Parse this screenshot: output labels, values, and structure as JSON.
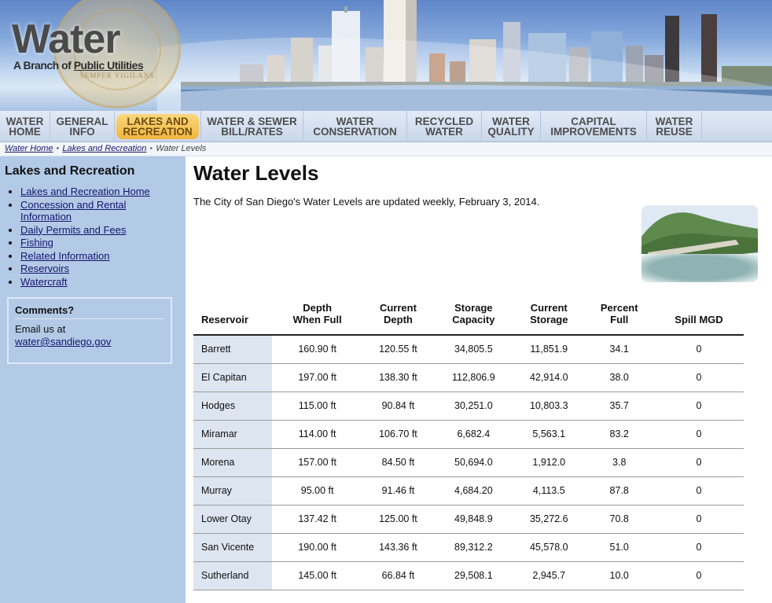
{
  "header": {
    "title": "Water",
    "subtitle_prefix": "A Branch of ",
    "subtitle_link": "Public Utilities",
    "seal_motto": "SEMPER VIGILANS"
  },
  "nav": [
    {
      "line1": "WATER",
      "line2": "HOME"
    },
    {
      "line1": "GENERAL",
      "line2": "INFO"
    },
    {
      "line1": "LAKES AND",
      "line2": "RECREATION",
      "active": true
    },
    {
      "line1": "WATER & SEWER",
      "line2": "BILL/RATES"
    },
    {
      "line1": "WATER",
      "line2": "CONSERVATION"
    },
    {
      "line1": "RECYCLED",
      "line2": "WATER"
    },
    {
      "line1": "WATER",
      "line2": "QUALITY"
    },
    {
      "line1": "CAPITAL",
      "line2": "IMPROVEMENTS"
    },
    {
      "line1": "WATER",
      "line2": "REUSE"
    }
  ],
  "breadcrumb": {
    "home": "Water Home",
    "section": "Lakes and Recreation",
    "current": "Water Levels",
    "separator": "•"
  },
  "sidebar": {
    "title": "Lakes and Recreation",
    "links": [
      "Lakes and Recreation Home",
      "Concession and Rental Information",
      "Daily Permits and Fees",
      "Fishing",
      "Related Information",
      "Reservoirs",
      "Watercraft"
    ],
    "comments": {
      "title": "Comments?",
      "text": "Email us at",
      "email": "water@sandiego.gov"
    }
  },
  "main": {
    "title": "Water Levels",
    "intro": "The City of San Diego's Water Levels are updated weekly, February 3, 2014."
  },
  "table": {
    "headers": [
      {
        "line1": "Reservoir",
        "line2": ""
      },
      {
        "line1": "Depth",
        "line2": "When Full"
      },
      {
        "line1": "Current",
        "line2": "Depth"
      },
      {
        "line1": "Storage",
        "line2": "Capacity"
      },
      {
        "line1": "Current",
        "line2": "Storage"
      },
      {
        "line1": "Percent",
        "line2": "Full"
      },
      {
        "line1": "Spill MGD",
        "line2": ""
      }
    ],
    "rows": [
      [
        "Barrett",
        "160.90 ft",
        "120.55 ft",
        "34,805.5",
        "11,851.9",
        "34.1",
        "0"
      ],
      [
        "El Capitan",
        "197.00 ft",
        "138.30 ft",
        "112,806.9",
        "42,914.0",
        "38.0",
        "0"
      ],
      [
        "Hodges",
        "115.00 ft",
        "90.84 ft",
        "30,251.0",
        "10,803.3",
        "35.7",
        "0"
      ],
      [
        "Miramar",
        "114.00 ft",
        "106.70 ft",
        "6,682.4",
        "5,563.1",
        "83.2",
        "0"
      ],
      [
        "Morena",
        "157.00 ft",
        "84.50 ft",
        "50,694.0",
        "1,912.0",
        "3.8",
        "0"
      ],
      [
        "Murray",
        "95.00 ft",
        "91.46 ft",
        "4,684.20",
        "4,113.5",
        "87.8",
        "0"
      ],
      [
        "Lower Otay",
        "137.42 ft",
        "125.00 ft",
        "49,848.9",
        "35,272.6",
        "70.8",
        "0"
      ],
      [
        "San Vicente",
        "190.00 ft",
        "143.36 ft",
        "89,312.2",
        "45,578.0",
        "51.0",
        "0"
      ],
      [
        "Sutherland",
        "145.00 ft",
        "66.84 ft",
        "29,508.1",
        "2,945.7",
        "10.0",
        "0"
      ]
    ]
  },
  "colors": {
    "sidebar_bg": "#b3cae6",
    "nav_active": "#f2b63f",
    "link": "#14146e"
  }
}
